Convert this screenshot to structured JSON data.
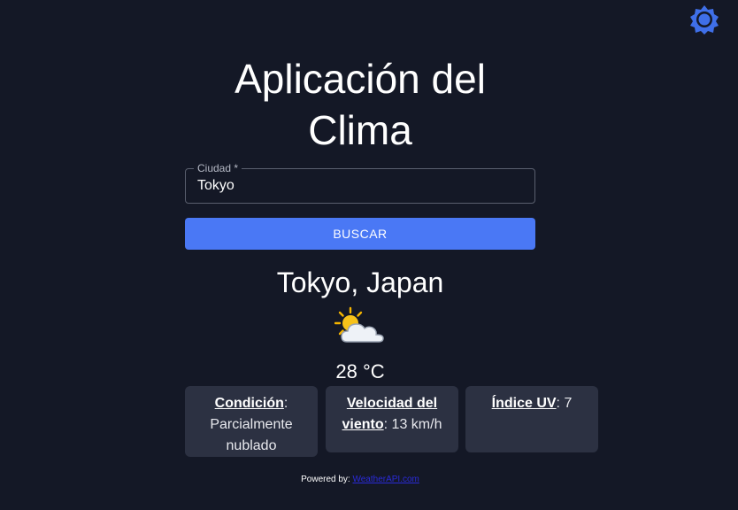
{
  "header": {
    "theme_toggle_icon": "sun-gear-icon",
    "accent": "#4a78f5"
  },
  "main": {
    "title": "Aplicación del Clima",
    "city_field": {
      "label": "Ciudad *",
      "value": "Tokyo"
    },
    "search_button": "BUSCAR"
  },
  "result": {
    "location": "Tokyo, Japan",
    "icon": "partly-cloudy-icon",
    "temperature": "28 °C",
    "cards": [
      {
        "label": "Condición",
        "value": ": Parcialmente nublado"
      },
      {
        "label": "Velocidad del viento",
        "value": ": 13 km/h"
      },
      {
        "label": "Índice UV",
        "value": ": 7"
      }
    ]
  },
  "footer": {
    "prefix": "Powered by:",
    "link_text": "WeatherAPI.com"
  }
}
